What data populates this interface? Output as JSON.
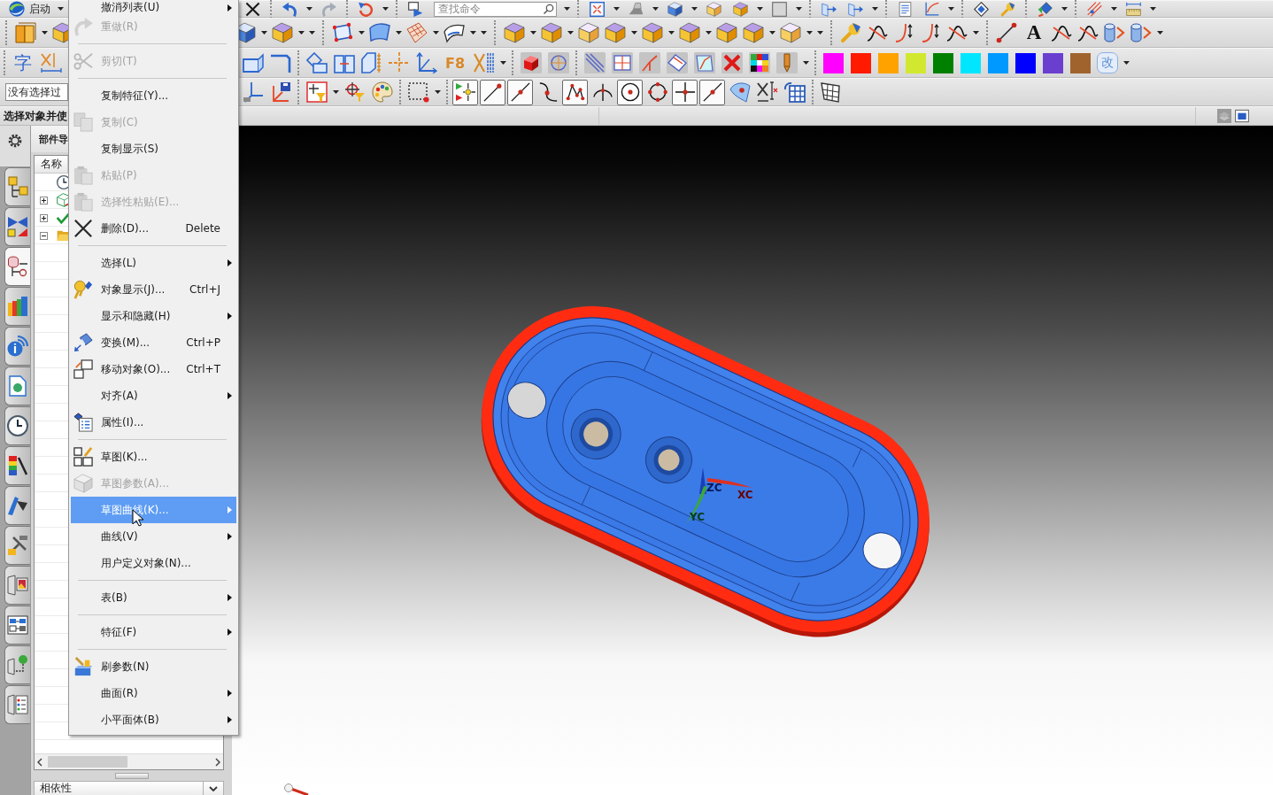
{
  "toolbars": {
    "start_button": "启动",
    "search": {
      "placeholder": "查找命令"
    },
    "glyph_buttons": [
      {
        "label": "字"
      },
      {
        "label": "F8"
      },
      {
        "label": "A"
      },
      {
        "label": "改"
      }
    ],
    "colors": [
      {
        "color": "#ff00ff"
      },
      {
        "color": "#ff1a00"
      },
      {
        "color": "#ffa200"
      },
      {
        "color": "#d2e830"
      },
      {
        "color": "#008000"
      },
      {
        "color": "#00e6ff"
      },
      {
        "color": "#0099ff"
      },
      {
        "color": "#0000ff"
      },
      {
        "color": "#6a3fd0"
      },
      {
        "color": "#a0632e"
      }
    ],
    "selection_filter": {
      "value": "没有选择过"
    },
    "snap_points": [
      {
        "on": true
      },
      {
        "on": true
      },
      {
        "on": true
      },
      {
        "on": false
      },
      {
        "on": true
      },
      {
        "on": false
      },
      {
        "on": true
      },
      {
        "on": false
      },
      {
        "on": true
      },
      {
        "on": true
      }
    ]
  },
  "status_bar": {
    "prompt": "选择对象并使"
  },
  "resource_bar": {
    "tabs": [
      {
        "selected": false
      },
      {
        "selected": false
      },
      {
        "selected": true
      },
      {
        "selected": false
      },
      {
        "selected": false
      },
      {
        "selected": false
      },
      {
        "selected": false
      },
      {
        "selected": false
      },
      {
        "selected": false
      },
      {
        "selected": false
      },
      {
        "selected": false
      },
      {
        "selected": false
      },
      {
        "selected": false
      },
      {
        "selected": false
      }
    ]
  },
  "part_navigator": {
    "title": "部件导",
    "columns": [
      "名称"
    ],
    "nodes": [
      {
        "expanded": false
      },
      {
        "expanded": false
      },
      {
        "expanded": true
      }
    ],
    "footer": "相依性"
  },
  "context_menu": {
    "groups": [
      {
        "items": [
          {
            "label": "撤消列表(U)",
            "submenu": true,
            "disabled": false,
            "selected": false
          },
          {
            "label": "重做(R)",
            "submenu": false,
            "disabled": true,
            "selected": false
          }
        ]
      },
      {
        "items": [
          {
            "label": "剪切(T)",
            "submenu": false,
            "disabled": true,
            "selected": false
          }
        ]
      },
      {
        "items": [
          {
            "label": "复制特征(Y)...",
            "submenu": false,
            "disabled": false,
            "selected": false
          },
          {
            "label": "复制(C)",
            "submenu": false,
            "disabled": true,
            "selected": false
          },
          {
            "label": "复制显示(S)",
            "submenu": false,
            "disabled": false,
            "selected": false
          },
          {
            "label": "粘贴(P)",
            "submenu": false,
            "disabled": true,
            "selected": false
          },
          {
            "label": "选择性粘贴(E)...",
            "submenu": false,
            "disabled": true,
            "selected": false
          },
          {
            "label": "删除(D)...",
            "shortcut": "Delete",
            "submenu": false,
            "disabled": false,
            "selected": false
          }
        ]
      },
      {
        "items": [
          {
            "label": "选择(L)",
            "submenu": true,
            "disabled": false,
            "selected": false
          },
          {
            "label": "对象显示(J)...",
            "shortcut": "Ctrl+J",
            "submenu": false,
            "disabled": false,
            "selected": false
          },
          {
            "label": "显示和隐藏(H)",
            "submenu": true,
            "disabled": false,
            "selected": false
          },
          {
            "label": "变换(M)...",
            "shortcut": "Ctrl+P",
            "submenu": false,
            "disabled": false,
            "selected": false
          },
          {
            "label": "移动对象(O)...",
            "shortcut": "Ctrl+T",
            "submenu": false,
            "disabled": false,
            "selected": false
          },
          {
            "label": "对齐(A)",
            "submenu": true,
            "disabled": false,
            "selected": false
          },
          {
            "label": "属性(I)...",
            "submenu": false,
            "disabled": false,
            "selected": false
          }
        ]
      },
      {
        "items": [
          {
            "label": "草图(K)...",
            "submenu": false,
            "disabled": false,
            "selected": false
          },
          {
            "label": "草图参数(A)...",
            "submenu": false,
            "disabled": true,
            "selected": false
          },
          {
            "label": "草图曲线(K)...",
            "submenu": true,
            "disabled": false,
            "selected": true
          },
          {
            "label": "曲线(V)",
            "submenu": true,
            "disabled": false,
            "selected": false
          },
          {
            "label": "用户定义对象(N)...",
            "submenu": false,
            "disabled": false,
            "selected": false
          }
        ]
      },
      {
        "items": [
          {
            "label": "表(B)",
            "submenu": true,
            "disabled": false,
            "selected": false
          }
        ]
      },
      {
        "items": [
          {
            "label": "特征(F)",
            "submenu": true,
            "disabled": false,
            "selected": false
          }
        ]
      },
      {
        "items": [
          {
            "label": "刷参数(N)",
            "submenu": false,
            "disabled": false,
            "selected": false
          },
          {
            "label": "曲面(R)",
            "submenu": true,
            "disabled": false,
            "selected": false
          },
          {
            "label": "小平面体(B)",
            "submenu": true,
            "disabled": false,
            "selected": false
          }
        ]
      }
    ]
  },
  "viewport": {
    "axis_labels": [
      "ZC",
      "XC",
      "YC"
    ]
  }
}
